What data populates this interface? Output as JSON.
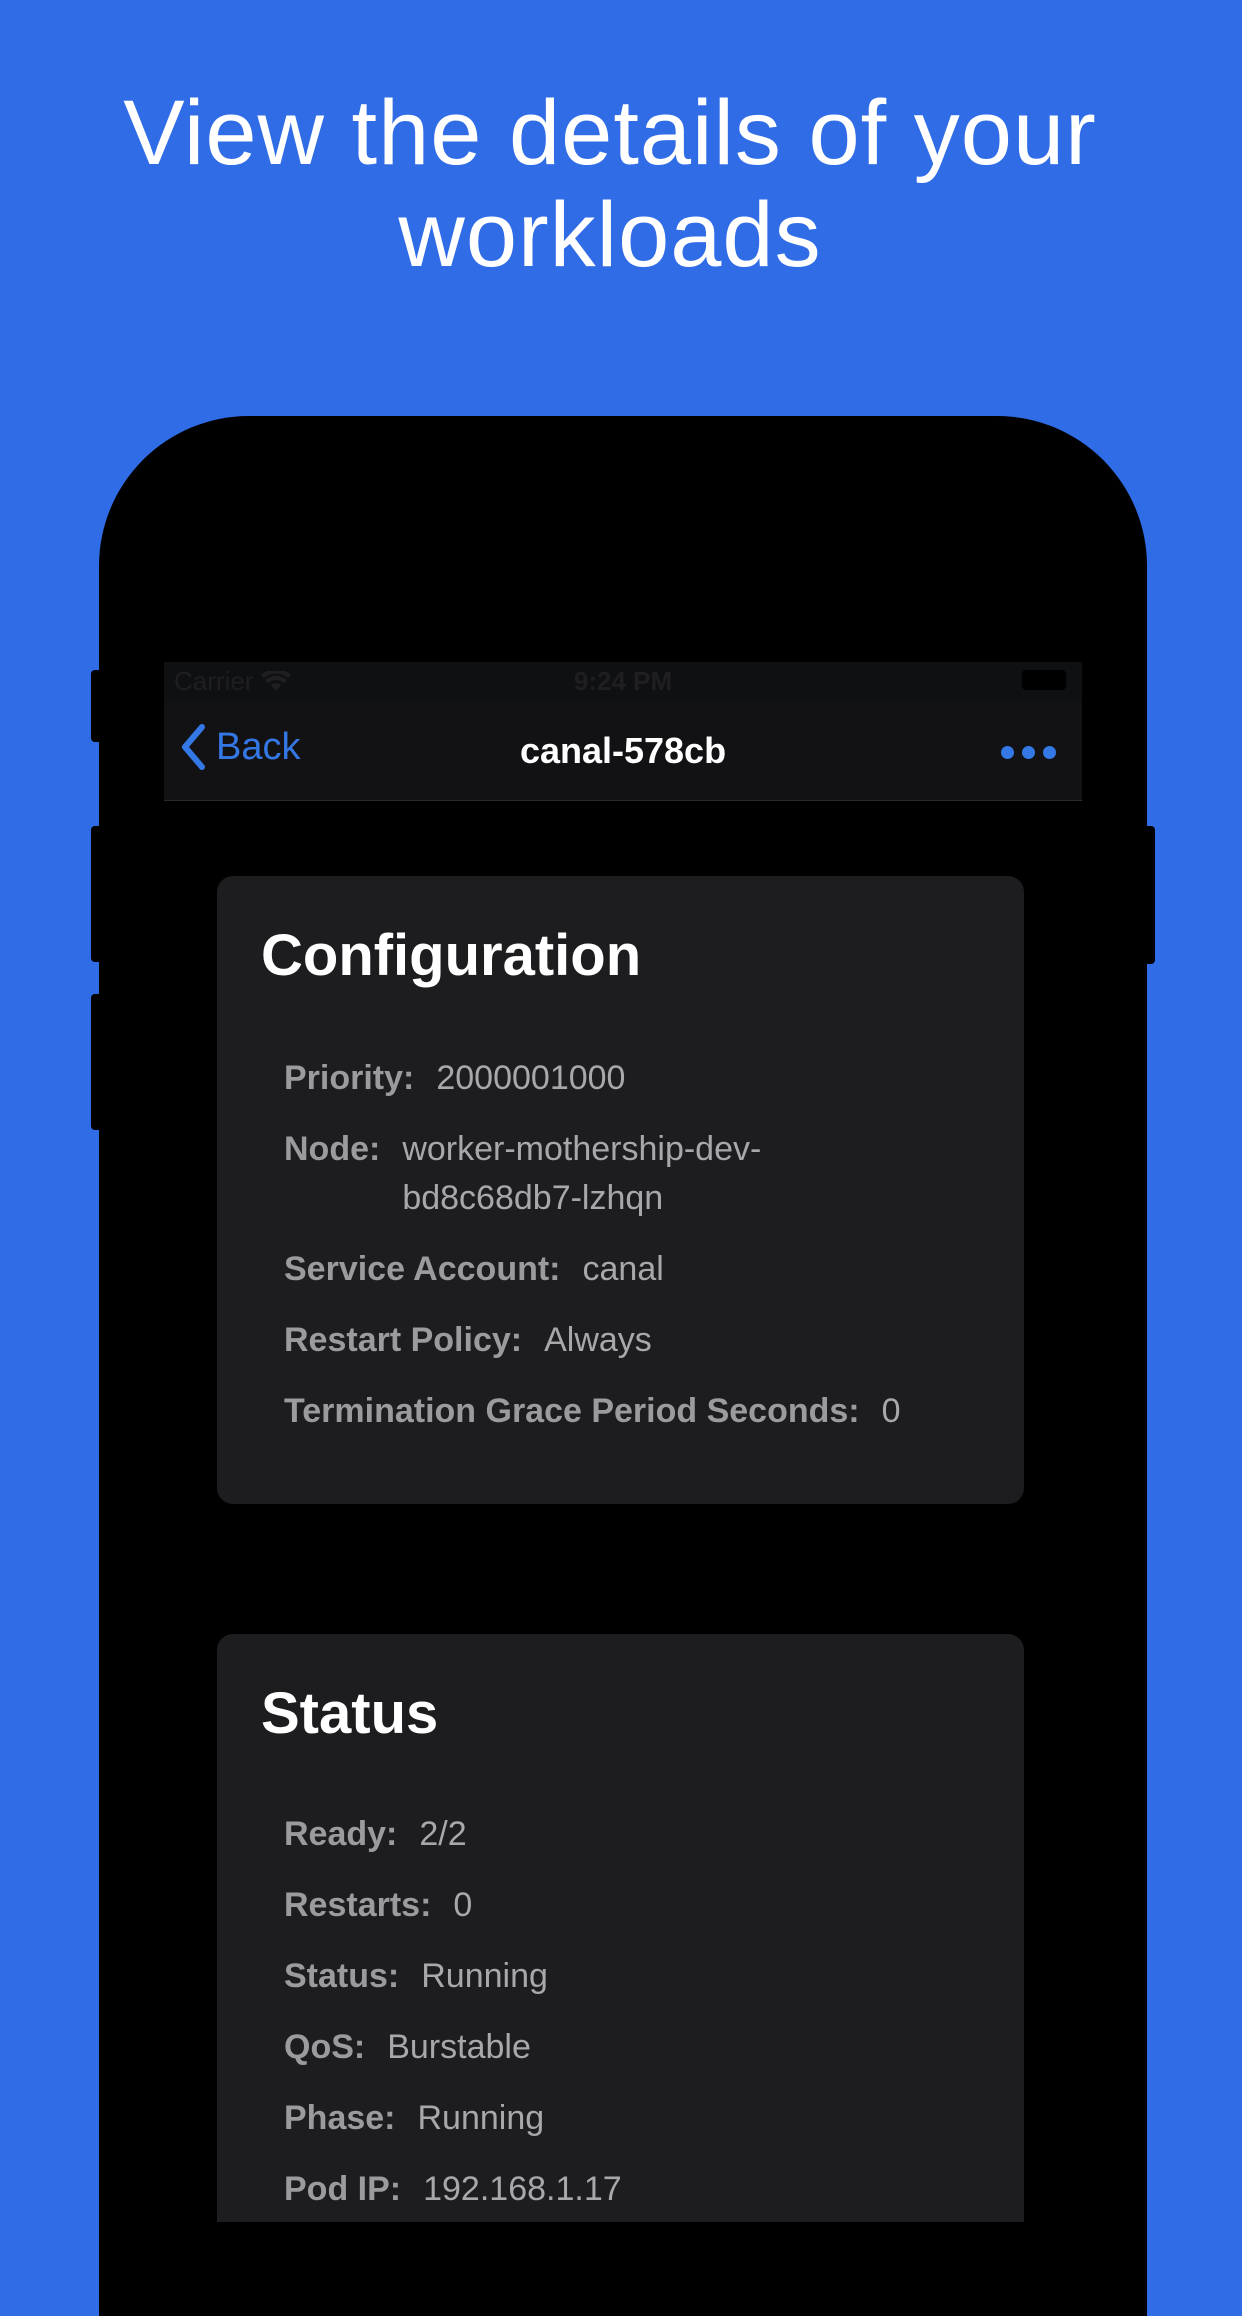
{
  "headline": {
    "line1": "View the details of your",
    "line2": "workloads"
  },
  "status_bar": {
    "carrier": "Carrier",
    "time": "9:24 PM"
  },
  "nav": {
    "back_label": "Back",
    "title": "canal-578cb"
  },
  "configuration": {
    "title": "Configuration",
    "rows": [
      {
        "key": "Priority:",
        "value": "2000001000"
      },
      {
        "key": "Node:",
        "value": "worker-mothership-dev-bd8c68db7-lzhqn"
      },
      {
        "key": "Service Account:",
        "value": "canal"
      },
      {
        "key": "Restart Policy:",
        "value": "Always"
      },
      {
        "key": "Termination Grace Period Seconds:",
        "value": "0"
      }
    ]
  },
  "status": {
    "title": "Status",
    "rows": [
      {
        "key": "Ready:",
        "value": "2/2"
      },
      {
        "key": "Restarts:",
        "value": "0"
      },
      {
        "key": "Status:",
        "value": "Running"
      },
      {
        "key": "QoS:",
        "value": "Burstable"
      },
      {
        "key": "Phase:",
        "value": "Running"
      },
      {
        "key": "Pod IP:",
        "value": "192.168.1.17"
      }
    ]
  },
  "colors": {
    "background": "#306ce6",
    "accent": "#3478e6",
    "card": "#1d1d1f"
  }
}
